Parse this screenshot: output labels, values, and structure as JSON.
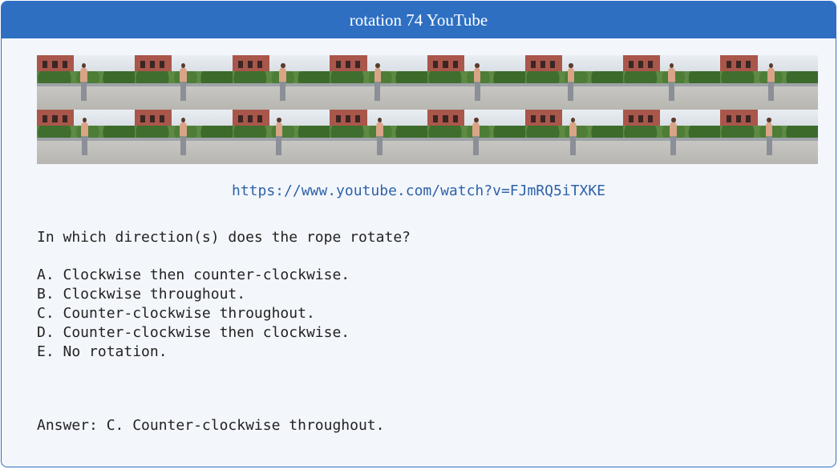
{
  "header": {
    "title": "rotation 74 YouTube"
  },
  "frames": {
    "count": 16,
    "person_offsets": [
      0.48,
      0.5,
      0.52,
      0.49,
      0.51,
      0.47,
      0.5,
      0.52,
      0.49,
      0.5,
      0.48,
      0.51,
      0.5,
      0.49,
      0.52,
      0.5
    ]
  },
  "link": {
    "url": "https://www.youtube.com/watch?v=FJmRQ5iTXKE"
  },
  "question": {
    "text": "In which direction(s) does the rope rotate?"
  },
  "options": [
    {
      "label": "A. Clockwise then counter-clockwise."
    },
    {
      "label": "B. Clockwise throughout."
    },
    {
      "label": "C. Counter-clockwise throughout."
    },
    {
      "label": "D. Counter-clockwise then clockwise."
    },
    {
      "label": "E. No rotation."
    }
  ],
  "answer": {
    "text": "Answer: C. Counter-clockwise throughout."
  },
  "colors": {
    "accent": "#2e6fc2",
    "link": "#2f62a8",
    "background": "#f3f6fb"
  }
}
